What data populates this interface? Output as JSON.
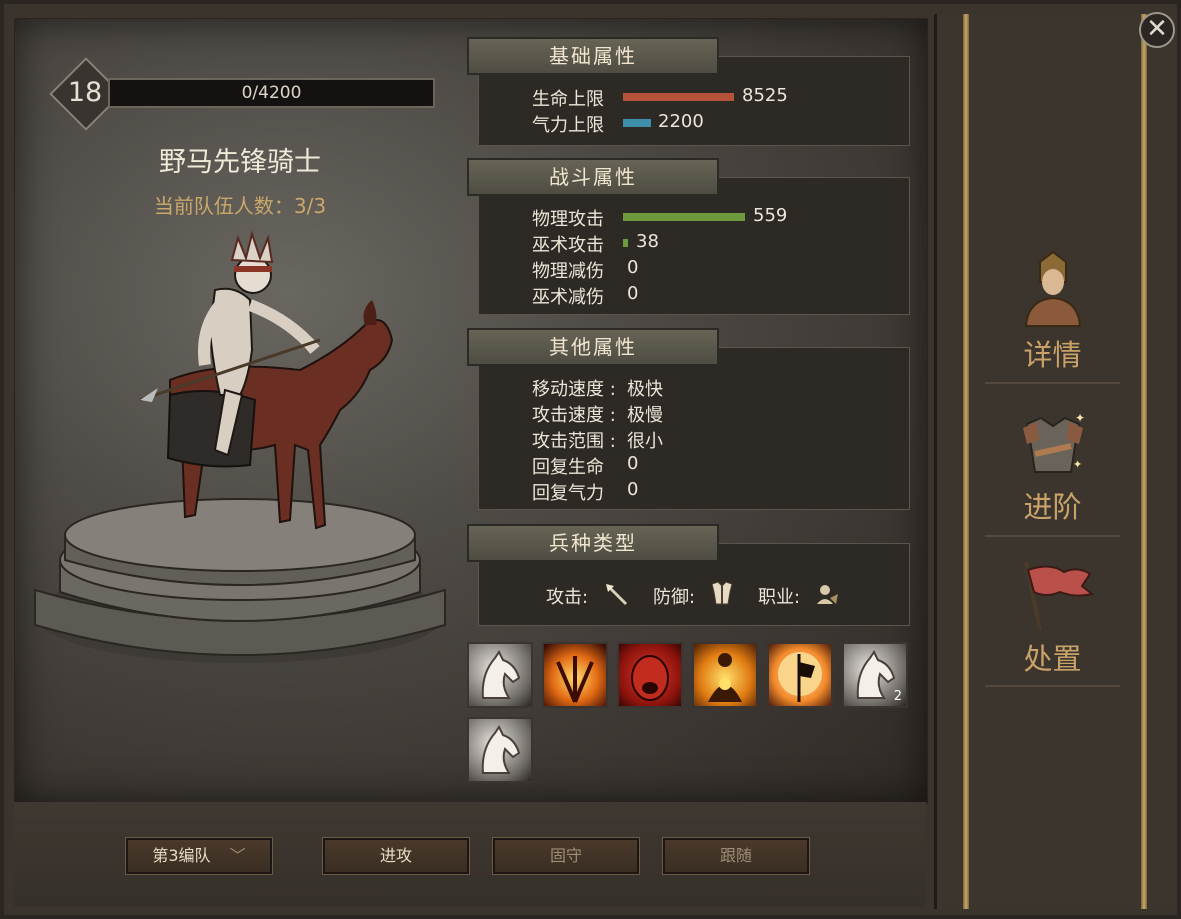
{
  "unit": {
    "level": "18",
    "xp_text": "0/4200",
    "name": "野马先锋骑士",
    "team_count": "当前队伍人数：3/3"
  },
  "basic": {
    "title": "基础属性",
    "rows": [
      {
        "label": "生命上限",
        "value": "8525",
        "color": "#b4523a"
      },
      {
        "label": "气力上限",
        "value": "2200",
        "color": "#3f8eaa"
      }
    ]
  },
  "combat": {
    "title": "战斗属性",
    "rows": [
      {
        "label": "物理攻击",
        "value": "559",
        "color": "#6e9a3e"
      },
      {
        "label": "巫术攻击",
        "value": "38",
        "color": "#6e9a3e"
      },
      {
        "label": "物理减伤",
        "value": "0"
      },
      {
        "label": "巫术减伤",
        "value": "0"
      }
    ]
  },
  "other": {
    "title": "其他属性",
    "rows": [
      {
        "label": "移动速度 :",
        "value": "极快"
      },
      {
        "label": "攻击速度 :",
        "value": "极慢"
      },
      {
        "label": "攻击范围 :",
        "value": "很小"
      },
      {
        "label": "回复生命",
        "value": "0"
      },
      {
        "label": "回复气力",
        "value": "0"
      }
    ]
  },
  "type": {
    "title": "兵种类型",
    "attack_label": "攻击:",
    "defense_label": "防御:",
    "class_label": "职业:"
  },
  "skills": [
    {
      "name": "horse-head"
    },
    {
      "name": "fire-spears"
    },
    {
      "name": "red-shout"
    },
    {
      "name": "golden-warrior"
    },
    {
      "name": "banner-sun"
    },
    {
      "name": "horse-head",
      "count": "2"
    },
    {
      "name": "horse-head"
    }
  ],
  "buttons": {
    "formation": "第3编队",
    "attack": "进攻",
    "hold": "固守",
    "follow": "跟随"
  },
  "nav": {
    "details": "详情",
    "advance": "进阶",
    "dispose": "处置"
  },
  "colors": {
    "hp_bar": "#b4523a",
    "mp_bar": "#3f8eaa",
    "atk_bar": "#6e9a3e",
    "nav_text": "#c9a26a",
    "team_text": "#c9a86a"
  }
}
